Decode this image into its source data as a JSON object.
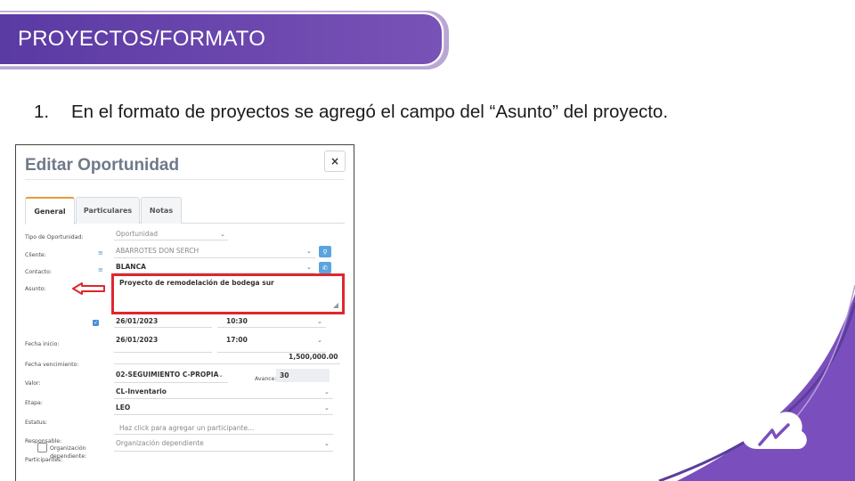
{
  "header": {
    "title": "PROYECTOS/FORMATO"
  },
  "bullet": {
    "number": "1.",
    "text": "En el formato de proyectos se agregó el campo del “Asunto” del proyecto."
  },
  "dialog": {
    "title": "Editar Oportunidad",
    "close_glyph": "×",
    "tabs": [
      "General",
      "Particulares",
      "Notas"
    ],
    "fields": {
      "tipo": {
        "label": "Tipo de Oportunidad:",
        "value": "Oportunidad"
      },
      "cliente": {
        "label": "Cliente:",
        "value": "ABARROTES DON SERCH"
      },
      "contacto": {
        "label": "Contacto:",
        "value": "BLANCA"
      },
      "asunto": {
        "label": "Asunto:",
        "value": "Proyecto de remodelación de bodega sur"
      },
      "fecha_inicio": {
        "label": "Fecha inicio:",
        "date": "26/01/2023",
        "time": "10:30"
      },
      "fecha_venc": {
        "label": "Fecha vencimiento:",
        "date": "26/01/2023",
        "time": "17:00"
      },
      "valor": {
        "label": "Valor:",
        "value": "1,500,000.00"
      },
      "etapa": {
        "label": "Etapa:",
        "value": "02-SEGUIMIENTO C-PROPIA",
        "avance_label": "Avance:",
        "avance_value": "30"
      },
      "estatus": {
        "label": "Estatus:",
        "value": "CL-Inventario"
      },
      "responsable": {
        "label": "Responsable:",
        "value": "LEO"
      },
      "participantes": {
        "label": "Participantes:",
        "placeholder": "Haz click para agregar un participante..."
      },
      "org_dep": {
        "label": "Organización dependiente:",
        "placeholder": "Organización dependiente"
      }
    }
  },
  "colors": {
    "banner": "#6a46ad",
    "highlight": "#e0262e",
    "accent_tab": "#e89a38",
    "button": "#5aa5e0"
  },
  "icons": {
    "close": "close-icon",
    "search": "search-icon",
    "phone": "phone-icon",
    "arrow": "left-arrow-icon",
    "logo": "cloud-logo-icon"
  }
}
